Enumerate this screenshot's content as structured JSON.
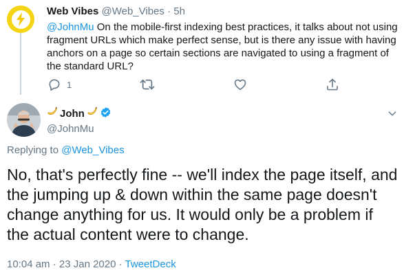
{
  "parent_tweet": {
    "display_name": "Web Vibes",
    "handle": "@Web_Vibes",
    "separator": "·",
    "time": "5h",
    "mention": "@JohnMu",
    "text": " On the mobile-first indexing best practices, it talks about not using fragment URLs which make perfect sense, but is there any issue with having anchors on a page so certain sections are navigated to using a fragment of the standard URL?",
    "reply_count": "1",
    "avatar_color": "#f5d414"
  },
  "main_tweet": {
    "display_name": "John",
    "handle": "@JohnMu",
    "replying_prefix": "Replying to ",
    "replying_to": "@Web_Vibes",
    "text": "No, that's perfectly fine -- we'll index the page itself, and the jumping up & down within the same page doesn't change anything for us. It would only be a problem if the actual content were to change.",
    "timestamp": "10:04 am · 23 Jan 2020 · ",
    "source": "TweetDeck"
  },
  "colors": {
    "link": "#1b95e0",
    "muted": "#657786",
    "verified": "#1da1f2"
  },
  "icons": [
    "lightning-icon",
    "reply-icon",
    "retweet-icon",
    "like-icon",
    "share-icon",
    "banana-icon",
    "verified-icon",
    "chevron-down-icon"
  ]
}
